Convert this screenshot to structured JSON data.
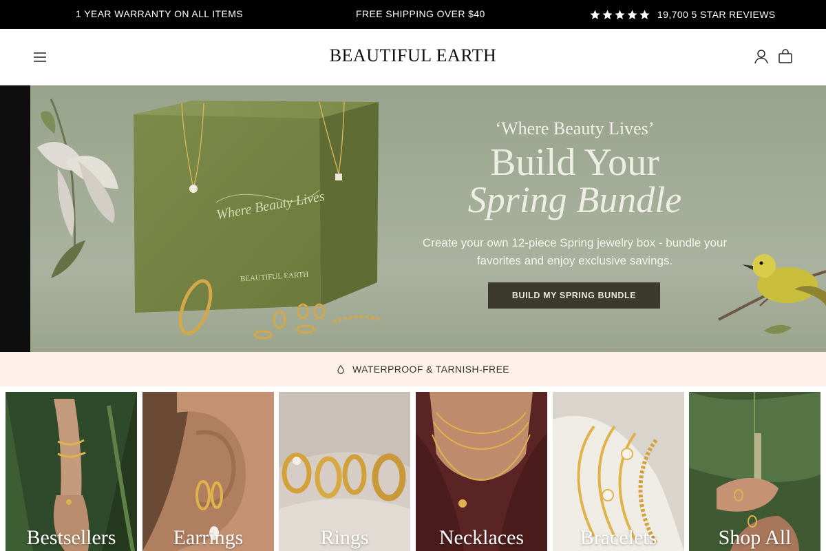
{
  "announcement": {
    "warranty": "1 YEAR WARRANTY ON ALL ITEMS",
    "shipping": "FREE SHIPPING OVER $40",
    "reviews": "19,700 5 STAR REVIEWS",
    "rating_stars": 5,
    "star_icon": "star-icon"
  },
  "header": {
    "logo": "BEAUTIFUL EARTH",
    "menu_icon": "hamburger-menu-icon",
    "account_icon": "user-account-icon",
    "cart_icon": "shopping-bag-icon"
  },
  "hero": {
    "eyebrow": "‘Where Beauty Lives’",
    "title_line1": "Build Your",
    "title_line2": "Spring Bundle",
    "subtitle": "Create your own 12-piece Spring jewelry box - bundle your favorites and enjoy exclusive savings.",
    "cta": "BUILD MY SPRING BUNDLE",
    "box_script": "Where Beauty Lives",
    "box_brand": "BEAUTIFUL EARTH",
    "background_color": "#a4ad97",
    "cta_color": "#3b3a2c"
  },
  "feature_bar": {
    "icon": "water-drop-icon",
    "text": "WATERPROOF & TARNISH-FREE",
    "background_color": "#fdf1ea"
  },
  "categories": [
    {
      "label": "Bestsellers"
    },
    {
      "label": "Earrings"
    },
    {
      "label": "Rings"
    },
    {
      "label": "Necklaces"
    },
    {
      "label": "Bracelets"
    },
    {
      "label": "Shop All"
    }
  ]
}
